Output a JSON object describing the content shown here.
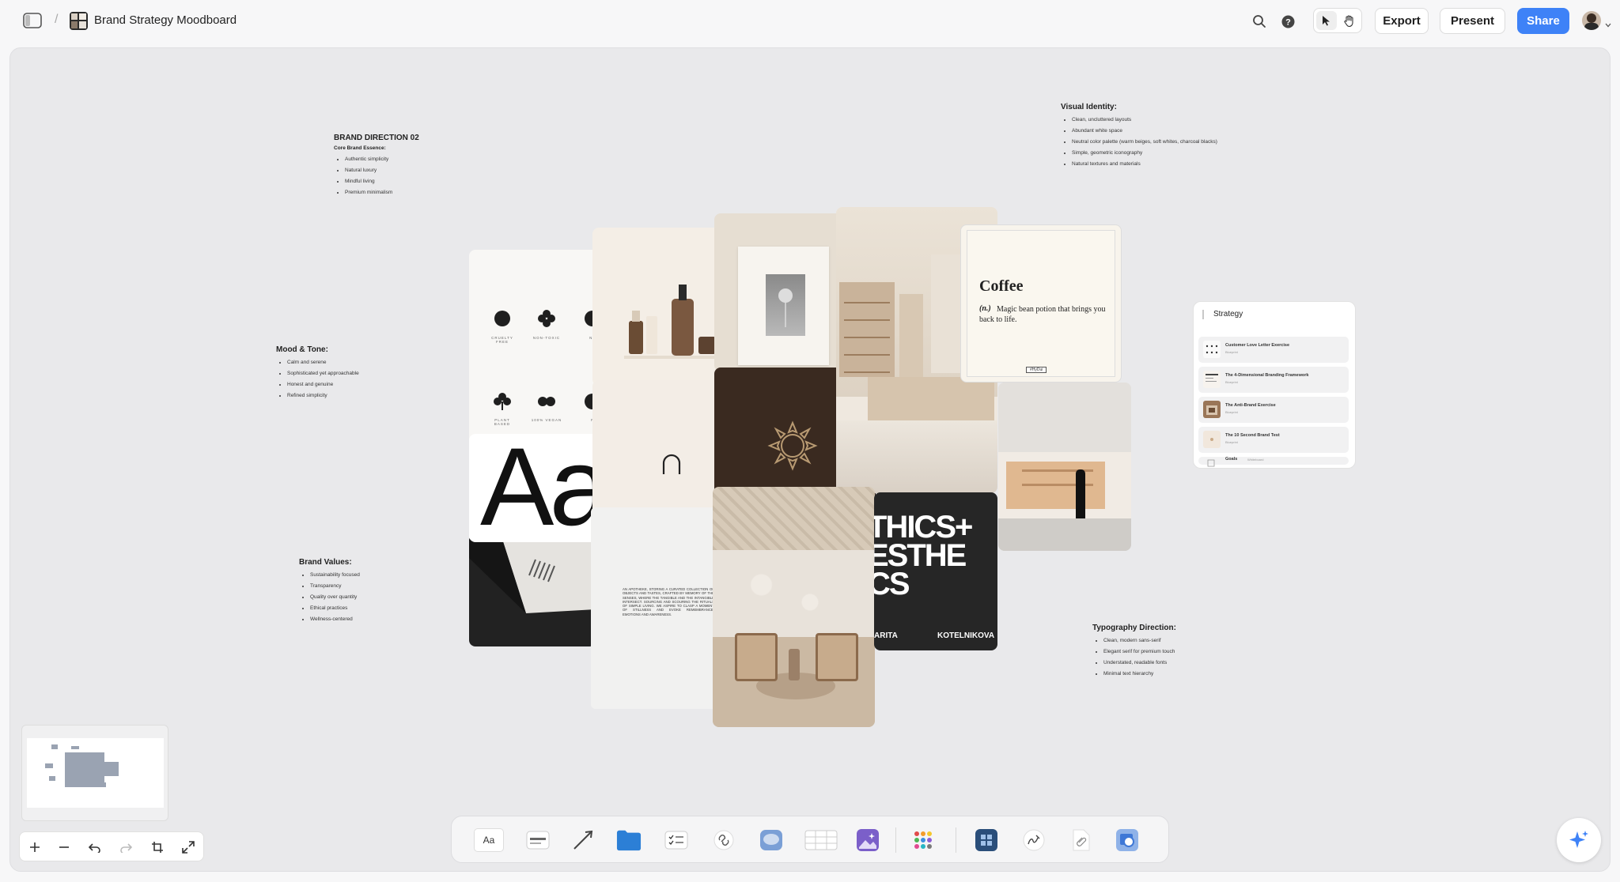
{
  "header": {
    "title": "Brand Strategy Moodboard",
    "breadcrumb_sep": "/",
    "export_label": "Export",
    "present_label": "Present",
    "share_label": "Share"
  },
  "notes": {
    "direction": {
      "title": "BRAND DIRECTION 02",
      "subtitle": "Core Brand Essence:",
      "items": [
        "Authentic simplicity",
        "Natural luxury",
        "Mindful living",
        "Premium minimalism"
      ]
    },
    "mood": {
      "title": "Mood & Tone:",
      "items": [
        "Calm and serene",
        "Sophisticated yet approachable",
        "Honest and genuine",
        "Refined simplicity"
      ]
    },
    "values": {
      "title": "Brand Values:",
      "items": [
        "Sustainability focused",
        "Transparency",
        "Quality over quantity",
        "Ethical practices",
        "Wellness-centered"
      ]
    },
    "visual": {
      "title": "Visual Identity:",
      "items": [
        "Clean, uncluttered layouts",
        "Abundant white space",
        "Neutral color palette (warm beiges, soft whites, charcoal blacks)",
        "Simple, geometric iconography",
        "Natural textures and materials"
      ]
    },
    "typography": {
      "title": "Typography Direction:",
      "items": [
        "Clean, modern sans-serif",
        "Elegant serif for premium touch",
        "Understated, readable fonts",
        "Minimal text hierarchy"
      ]
    }
  },
  "cards": {
    "icons": {
      "labels": [
        "CRUELTY FREE",
        "NON-TOXIC",
        "NAT",
        "PLANT BASED",
        "100% VEGAN",
        "PA"
      ]
    },
    "type_specimen": "Aa",
    "coffee": {
      "title": "Coffee",
      "pos": "(n.)",
      "definition": "Magic bean potion that brings you back to life.",
      "tag": "#HyDui"
    },
    "poster": {
      "lines": [
        "THICS+",
        "ESTHE",
        "CS"
      ],
      "names": [
        "ARITA",
        "KOTELNIKOVA"
      ]
    },
    "paper_text": "AN APOTHEKE, STORING A CURATED COLLECTION OF OBJECTS AND TASTES, CRAFTED BY MEMORY OF THE SENSES, WHERE THE TANGIBLE AND THE INTANGIBLE INTERSECT. SOURCING AND SCOURING THE RITUALS OF SIMPLE LIVING. WE ASPIRE TO CLASP A MOMENT OF STILLNESS AND EVOKE REMEMBRANCE, EMOTIONS AND AWARENESS."
  },
  "strategy": {
    "title": "Strategy",
    "items": [
      {
        "title": "Customer Love Letter Exercise",
        "sub": "Blueprint"
      },
      {
        "title": "The 4-Dimensional Branding Framework",
        "sub": "Blueprint"
      },
      {
        "title": "The Anti-Brand Exercise",
        "sub": "Blueprint"
      },
      {
        "title": "The 10 Second Brand Test",
        "sub": "Blueprint"
      },
      {
        "title": "Goals",
        "sub": "Whiteboard"
      }
    ]
  },
  "toolbar": {
    "text_tool_label": "Aa"
  },
  "colors": {
    "accent": "#3e82f7",
    "canvas": "#e9e9eb",
    "dark_brown": "#3a2a20"
  }
}
